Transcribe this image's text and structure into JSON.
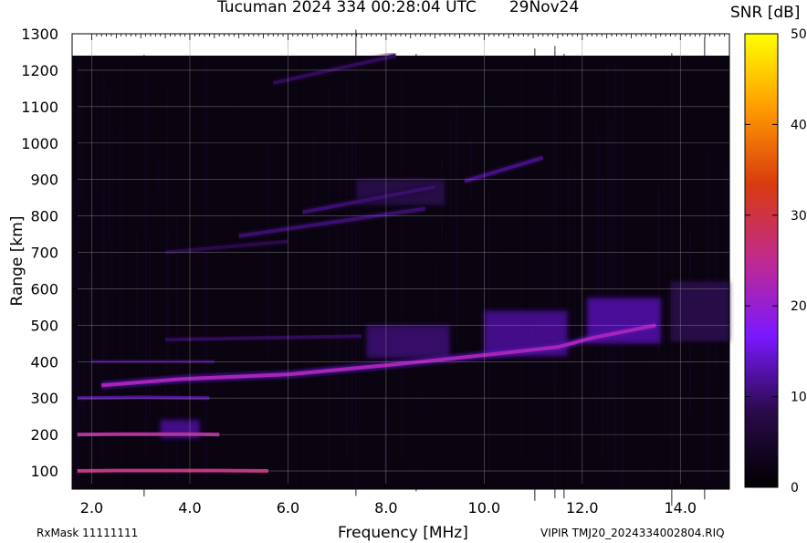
{
  "header": {
    "title": "Tucuman 2024 334 00:28:04 UTC",
    "date": "29Nov24"
  },
  "footer": {
    "rxmask": "RxMask 11111111",
    "file": "VIPIR  TMJ20_2024334002804.RIQ"
  },
  "colorbar": {
    "label": "SNR [dB]",
    "ticks": [
      0,
      10,
      20,
      30,
      40,
      50
    ],
    "range": [
      0,
      50
    ],
    "stops": [
      "#000000",
      "#2a0a4a",
      "#7a18ff",
      "#c02a90",
      "#d83a10",
      "#ff9a00",
      "#ffff00"
    ]
  },
  "chart_data": {
    "type": "heatmap",
    "xlabel": "Frequency [MHz]",
    "ylabel": "Range [km]",
    "xlim": [
      1.6,
      15.0
    ],
    "ylim": [
      50,
      1300
    ],
    "data_ymax": 1240,
    "xticks": [
      "2.0",
      "4.0",
      "6.0",
      "8.0",
      "10.0",
      "12.0",
      "14.0"
    ],
    "yticks": [
      "100",
      "200",
      "300",
      "400",
      "500",
      "600",
      "700",
      "800",
      "900",
      "1000",
      "1100",
      "1200",
      "1300"
    ],
    "grid": true,
    "background": "#0a0410",
    "traces": [
      {
        "points": [
          [
            1.7,
            100
          ],
          [
            2.6,
            101
          ],
          [
            4.6,
            101
          ],
          [
            5.6,
            100
          ]
        ],
        "snr": 26
      },
      {
        "points": [
          [
            1.7,
            200
          ],
          [
            2.6,
            201
          ],
          [
            4.0,
            201
          ],
          [
            4.6,
            200
          ]
        ],
        "snr": 24
      },
      {
        "points": [
          [
            1.7,
            300
          ],
          [
            3.0,
            302
          ],
          [
            4.4,
            300
          ]
        ],
        "snr": 12
      },
      {
        "points": [
          [
            2.2,
            335
          ],
          [
            3.8,
            352
          ],
          [
            6.0,
            365
          ],
          [
            8.0,
            390
          ],
          [
            10.0,
            418
          ],
          [
            11.5,
            440
          ],
          [
            12.2,
            465
          ],
          [
            13.5,
            500
          ]
        ],
        "snr": 22
      },
      {
        "points": [
          [
            2.0,
            400
          ],
          [
            4.5,
            400
          ]
        ],
        "snr": 9
      },
      {
        "points": [
          [
            3.5,
            460
          ],
          [
            7.5,
            470
          ]
        ],
        "snr": 9
      },
      {
        "points": [
          [
            5.7,
            1165
          ],
          [
            8.2,
            1240
          ]
        ],
        "snr": 9
      },
      {
        "points": [
          [
            5.0,
            745
          ],
          [
            8.8,
            820
          ]
        ],
        "snr": 10
      },
      {
        "points": [
          [
            6.3,
            810
          ],
          [
            9.0,
            880
          ]
        ],
        "snr": 10
      },
      {
        "points": [
          [
            3.5,
            700
          ],
          [
            6.0,
            730
          ]
        ],
        "snr": 8
      },
      {
        "points": [
          [
            9.6,
            895
          ],
          [
            11.2,
            960
          ]
        ],
        "snr": 11
      }
    ],
    "patches": [
      {
        "x": [
          7.6,
          9.3
        ],
        "y": [
          410,
          500
        ],
        "snr": 11
      },
      {
        "x": [
          10.0,
          11.7
        ],
        "y": [
          415,
          540
        ],
        "snr": 13
      },
      {
        "x": [
          12.1,
          13.6
        ],
        "y": [
          450,
          575
        ],
        "snr": 14
      },
      {
        "x": [
          13.8,
          15.0
        ],
        "y": [
          455,
          620
        ],
        "snr": 9
      },
      {
        "x": [
          3.4,
          4.2
        ],
        "y": [
          190,
          240
        ],
        "snr": 13
      },
      {
        "x": [
          7.4,
          9.2
        ],
        "y": [
          830,
          900
        ],
        "snr": 9
      }
    ]
  }
}
